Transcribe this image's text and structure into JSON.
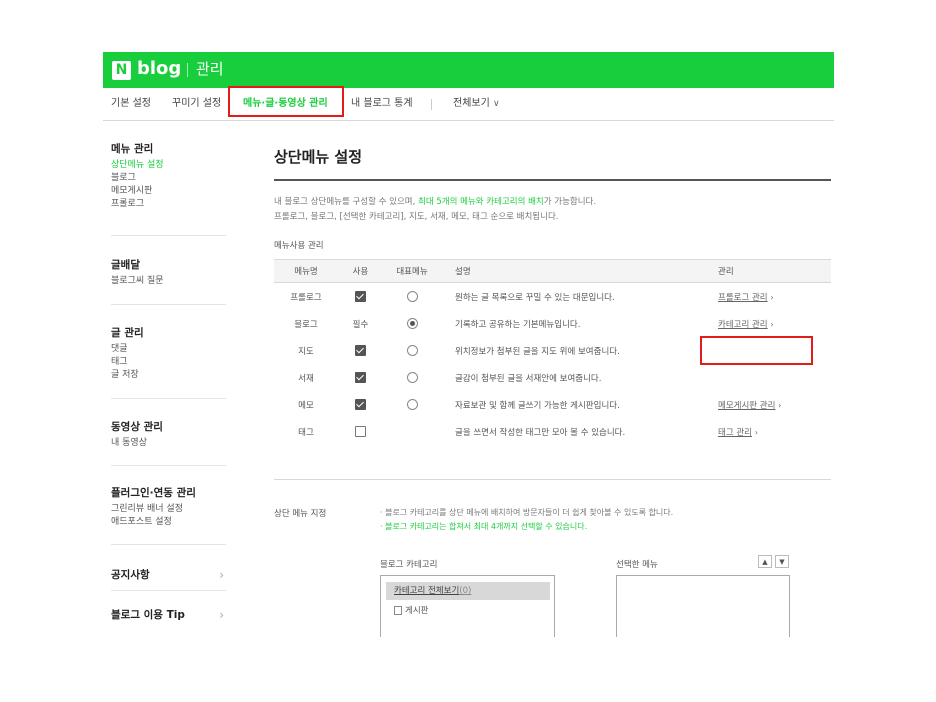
{
  "header": {
    "logo_mark": "N",
    "logo_text": "blog",
    "subtitle": "관리"
  },
  "tabs": [
    {
      "label": "기본 설정"
    },
    {
      "label": "꾸미기 설정"
    },
    {
      "label": "메뉴·글·동영상 관리",
      "active": true
    },
    {
      "label": "내 블로그 통계"
    },
    {
      "label": "전체보기"
    }
  ],
  "sidebar": {
    "menu": {
      "title": "메뉴 관리",
      "items": [
        "상단메뉴 설정",
        "블로그",
        "메모게시판",
        "프롤로그"
      ]
    },
    "delivery": {
      "title": "글배달",
      "items": [
        "블로그씨 질문"
      ]
    },
    "posts": {
      "title": "글 관리",
      "items": [
        "댓글",
        "태그",
        "글 저장"
      ]
    },
    "video": {
      "title": "동영상 관리",
      "items": [
        "내 동영상"
      ]
    },
    "plugin": {
      "title": "플러그인·연동 관리",
      "items": [
        "그린리뷰 배너 설정",
        "애드포스트 설정"
      ]
    },
    "notice": {
      "title": "공지사항"
    },
    "tip": {
      "title": "블로그 이용 Tip"
    }
  },
  "main": {
    "title": "상단메뉴 설정",
    "desc1_a": "내 블로그 상단메뉴를 구성할 수 있으며, ",
    "desc1_hl": "최대 5개의 메뉴와 카테고리의 배치",
    "desc1_b": "가 가능합니다.",
    "desc2": "프롤로그, 블로그, [선택한 카테고리], 지도, 서재, 메모, 태그 순으로 배치됩니다.",
    "usage_label": "메뉴사용 관리",
    "columns": {
      "name": "메뉴명",
      "use": "사용",
      "rep": "대표메뉴",
      "desc": "설명",
      "manage": "관리"
    },
    "rows": [
      {
        "name": "프롤로그",
        "use": "checked",
        "rep": false,
        "desc": "원하는 글 목록으로 꾸밀 수 있는 대문입니다.",
        "manage": "프롤로그 관리"
      },
      {
        "name": "블로그",
        "use": "필수",
        "rep": true,
        "desc": "기록하고 공유하는 기본메뉴입니다.",
        "manage": "카테고리 관리"
      },
      {
        "name": "지도",
        "use": "checked",
        "rep": false,
        "desc": "위치정보가 첨부된 글을 지도 위에 보여줍니다.",
        "manage": ""
      },
      {
        "name": "서재",
        "use": "checked",
        "rep": false,
        "desc": "글감이 첨부된 글을 서재안에 보여줍니다.",
        "manage": ""
      },
      {
        "name": "메모",
        "use": "checked",
        "rep": false,
        "desc": "자료보관 및 함께 글쓰기 가능한 게시판입니다.",
        "manage": "메모게시판 관리"
      },
      {
        "name": "태그",
        "use": "unchecked",
        "rep": null,
        "desc": "글을 쓰면서 작성한 태그만 모아 볼 수 있습니다.",
        "manage": "태그 관리"
      }
    ],
    "fixed_label": "상단 메뉴 지정",
    "note1": "· 블로그 카테고리를 상단 메뉴에 배치하여 방문자들이 더 쉽게 찾아볼 수 있도록 합니다.",
    "note2": "· 블로그 카테고리는 합쳐서 최대 4개까지 선택할 수 있습니다.",
    "category_label": "블로그 카테고리",
    "category_all": "카테고리 전체보기",
    "category_all_count": "(0)",
    "category_board": "게시판",
    "selected_label": "선택한 메뉴",
    "up": "▲",
    "down": "▼"
  },
  "colors": {
    "brand": "#19ce3c",
    "highlight": "#e21b1b"
  }
}
